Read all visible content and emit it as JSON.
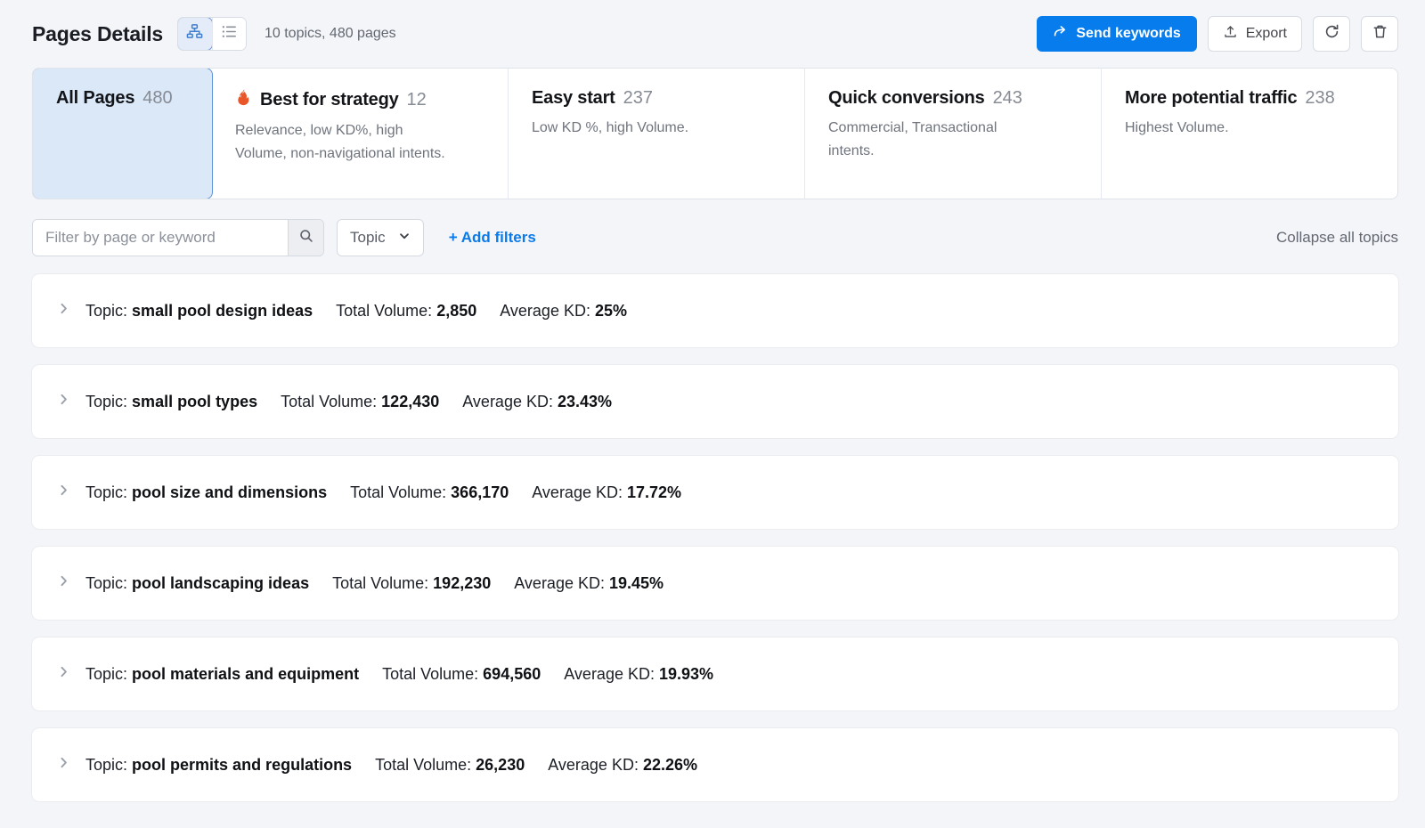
{
  "header": {
    "title": "Pages Details",
    "summary": "10 topics, 480 pages",
    "view_toggle": [
      {
        "name": "hierarchy-view",
        "icon": "sitemap-icon",
        "active": true
      },
      {
        "name": "list-view",
        "icon": "list-icon",
        "active": false
      }
    ],
    "send_keywords_label": "Send keywords",
    "export_label": "Export",
    "refresh_icon": "refresh-icon",
    "delete_icon": "trash-icon",
    "accent_color": "#067ced"
  },
  "tabs": [
    {
      "title": "All Pages",
      "count": "480",
      "desc": "",
      "icon": "",
      "active": true
    },
    {
      "title": "Best for strategy",
      "count": "12",
      "desc": "Relevance, low KD%, high Volume, non-navigational intents.",
      "icon": "flame-icon",
      "active": false
    },
    {
      "title": "Easy start",
      "count": "237",
      "desc": "Low KD %, high Volume.",
      "icon": "",
      "active": false
    },
    {
      "title": "Quick conversions",
      "count": "243",
      "desc": "Commercial, Transactional intents.",
      "icon": "",
      "active": false
    },
    {
      "title": "More potential traffic",
      "count": "238",
      "desc": "Highest Volume.",
      "icon": "",
      "active": false
    }
  ],
  "filters": {
    "search_placeholder": "Filter by page or keyword",
    "search_value": "",
    "search_icon": "search-icon",
    "topic_select_label": "Topic",
    "add_filters_label": "+ Add filters",
    "collapse_all_label": "Collapse all topics"
  },
  "labels": {
    "topic_prefix": "Topic:",
    "total_volume_prefix": "Total Volume:",
    "average_kd_prefix": "Average KD:"
  },
  "topics": [
    {
      "name": "small pool design ideas",
      "total_volume": "2,850",
      "average_kd": "25%"
    },
    {
      "name": "small pool types",
      "total_volume": "122,430",
      "average_kd": "23.43%"
    },
    {
      "name": "pool size and dimensions",
      "total_volume": "366,170",
      "average_kd": "17.72%"
    },
    {
      "name": "pool landscaping ideas",
      "total_volume": "192,230",
      "average_kd": "19.45%"
    },
    {
      "name": "pool materials and equipment",
      "total_volume": "694,560",
      "average_kd": "19.93%"
    },
    {
      "name": "pool permits and regulations",
      "total_volume": "26,230",
      "average_kd": "22.26%"
    }
  ],
  "colors": {
    "accent": "#067ced",
    "flame": "#e8562a",
    "active_tab_bg": "#dbe8f7",
    "page_bg": "#f4f5f9"
  }
}
